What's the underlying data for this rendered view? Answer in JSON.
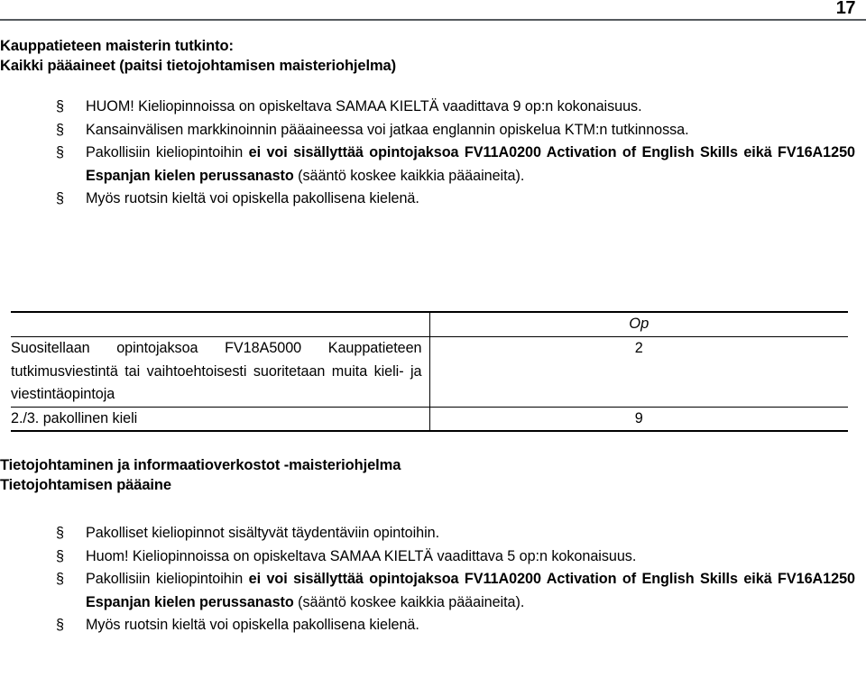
{
  "header": {
    "page_number": "17"
  },
  "document": {
    "title": "Kauppatieteen maisterin tutkinto:",
    "subtitle": "Kaikki pääaineet (paitsi tietojohtamisen maisteriohjelma)",
    "bullet_marker": "§",
    "bullets_top": [
      {
        "parts": [
          {
            "text": "HUOM! Kieliopinnoissa on opiskeltava SAMAA KIELTÄ vaadittava 9 op:n kokonaisuus.",
            "bold": false
          }
        ]
      },
      {
        "parts": [
          {
            "text": "Kansainvälisen markkinoinnin pääaineessa voi jatkaa englannin opiskelua KTM:n tutkinnossa.",
            "bold": false
          }
        ]
      },
      {
        "parts": [
          {
            "text": "Pakollisiin kieliopintoihin ",
            "bold": false
          },
          {
            "text": "ei voi sisällyttää opintojaksoa FV11A0200 Activation of English Skills eikä FV16A1250 Espanjan kielen perussanasto",
            "bold": true
          },
          {
            "text": " (sääntö koskee kaikkia pääaineita).",
            "bold": false
          }
        ]
      },
      {
        "parts": [
          {
            "text": "Myös ruotsin kieltä voi opiskella pakollisena kielenä.",
            "bold": false
          }
        ]
      }
    ]
  },
  "credit_table": {
    "columns": [
      "",
      "Op"
    ],
    "rows": [
      {
        "description": "Suositellaan opintojaksoa FV18A5000 Kauppatieteen tutkimusviestintä tai vaihtoehtoisesti suoritetaan muita kieli- ja viestintäopintoja",
        "credits": "2"
      },
      {
        "description": "2./3. pakollinen kieli",
        "credits": "9"
      }
    ]
  },
  "lower_section": {
    "program_title": "Tietojohtaminen ja informaatioverkostot -maisteriohjelma",
    "major_title": "Tietojohtamisen pääaine",
    "bullet_marker": "§",
    "bullets": [
      {
        "parts": [
          {
            "text": "Pakolliset kieliopinnot sisältyvät täydentäviin opintoihin.",
            "bold": false
          }
        ]
      },
      {
        "parts": [
          {
            "text": "Huom! Kieliopinnoissa on opiskeltava SAMAA KIELTÄ vaadittava 5 op:n kokonaisuus.",
            "bold": false
          }
        ]
      },
      {
        "parts": [
          {
            "text": "Pakollisiin kieliopintoihin ",
            "bold": false
          },
          {
            "text": "ei voi sisällyttää opintojaksoa FV11A0200 Activation of English Skills eikä FV16A1250 Espanjan kielen perussanasto",
            "bold": true
          },
          {
            "text": " (sääntö koskee kaikkia pääaineita).",
            "bold": false
          }
        ]
      },
      {
        "parts": [
          {
            "text": "Myös ruotsin kieltä voi opiskella pakollisena kielenä.",
            "bold": false
          }
        ]
      }
    ]
  },
  "colors": {
    "text": "#000000",
    "header_rule": "#555a5e",
    "table_border": "#000000"
  }
}
